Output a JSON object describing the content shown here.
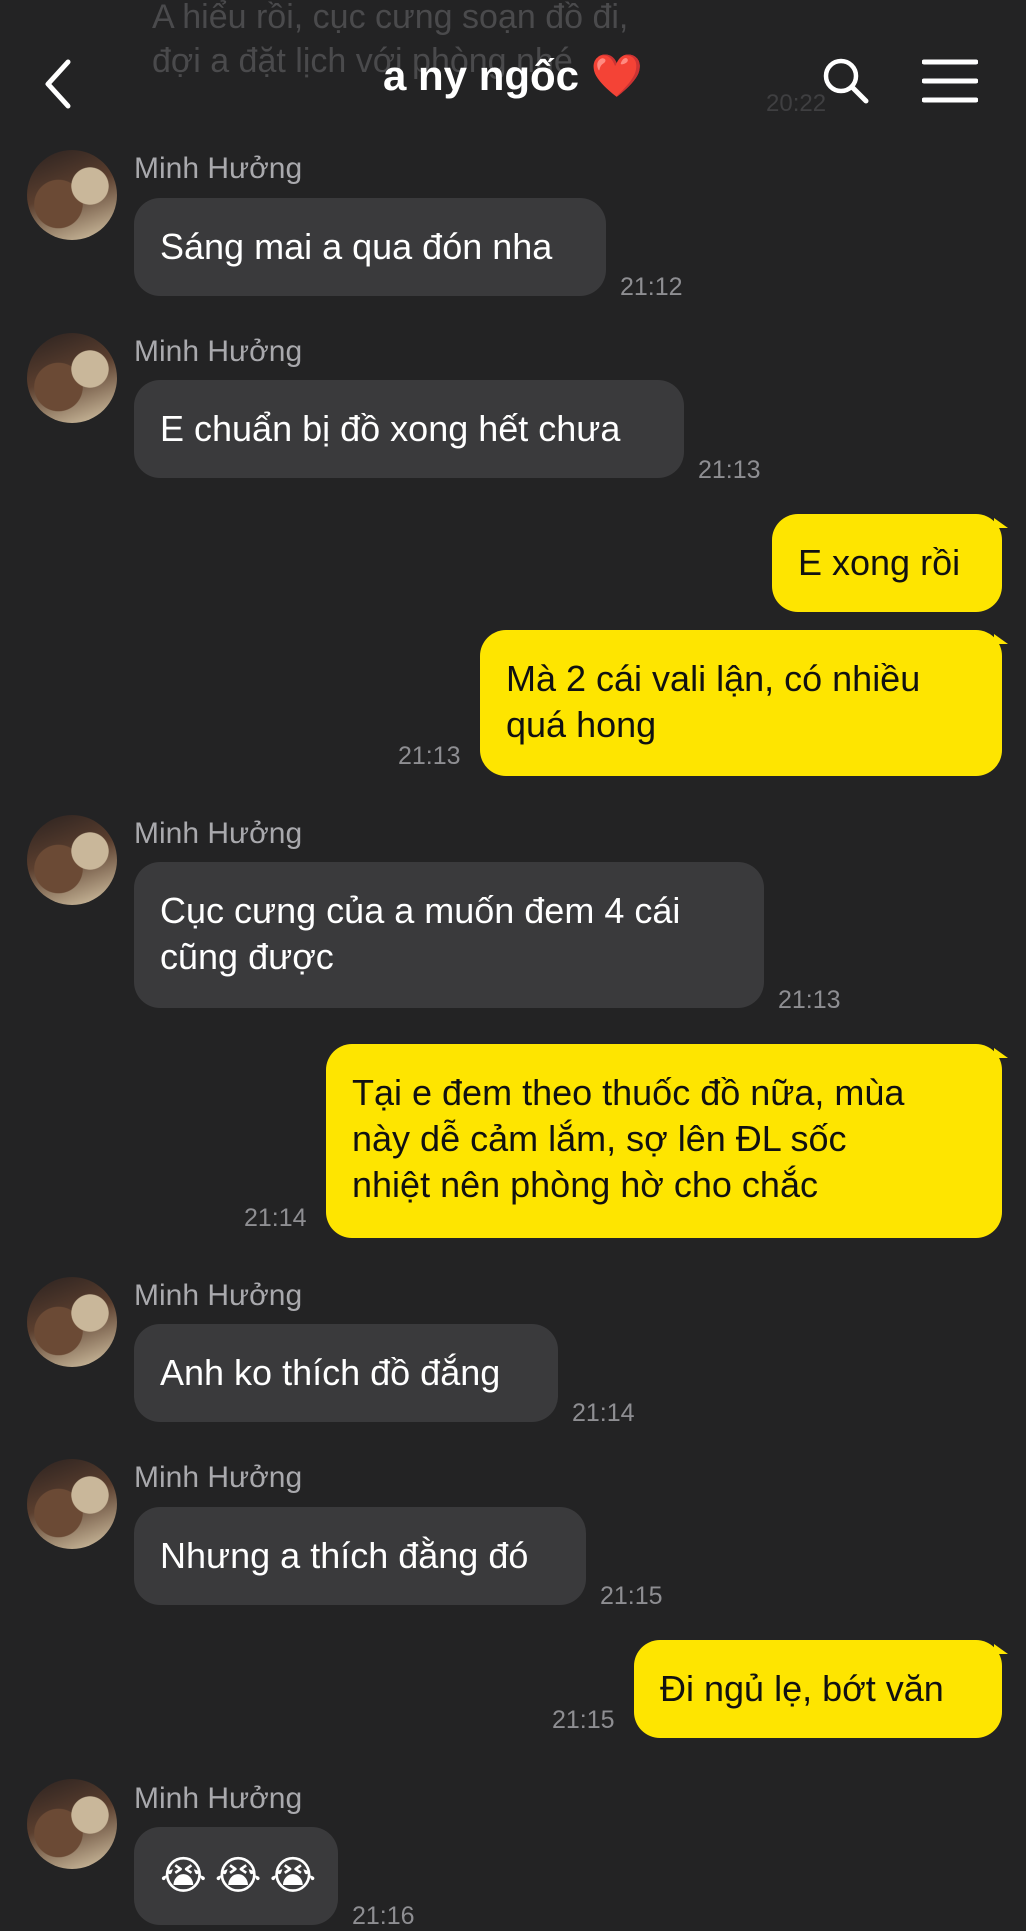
{
  "ghost": {
    "line1": "A hiểu rồi, cục cưng soạn đồ đi,",
    "line2": "đợi a đặt lịch với phòng nhé",
    "time": "20:22"
  },
  "header": {
    "title": "a ny ngốc",
    "heart": "❤️",
    "icons": [
      "back-arrow-icon",
      "search-icon",
      "menu-icon"
    ]
  },
  "colors": {
    "background": "#232324",
    "incoming_bubble": "#3a3a3c",
    "outgoing_bubble": "#fee500",
    "timestamp": "#8e8e92"
  },
  "messages": [
    {
      "direction": "in",
      "sender": "Minh Hưởng",
      "text": "Sáng mai a qua đón nha",
      "time": "21:12"
    },
    {
      "direction": "in",
      "sender": "Minh Hưởng",
      "text": "E chuẩn bị đồ xong hết chưa",
      "time": "21:13"
    },
    {
      "direction": "out",
      "text": "E xong rồi"
    },
    {
      "direction": "out",
      "lines": [
        "Mà 2 cái vali lận, có nhiều",
        "quá hong"
      ],
      "time": "21:13"
    },
    {
      "direction": "in",
      "sender": "Minh Hưởng",
      "lines": [
        "Cục cưng của a muốn đem 4 cái",
        "cũng được"
      ],
      "time": "21:13"
    },
    {
      "direction": "out",
      "lines": [
        "Tại e đem theo thuốc đồ nữa, mùa",
        "này dễ cảm lắm, sợ lên ĐL sốc",
        "nhiệt nên phòng hờ cho chắc"
      ],
      "time": "21:14"
    },
    {
      "direction": "in",
      "sender": "Minh Hưởng",
      "text": "Anh ko thích đồ đắng",
      "time": "21:14"
    },
    {
      "direction": "in",
      "sender": "Minh Hưởng",
      "text": "Nhưng a thích đằng đó",
      "time": "21:15"
    },
    {
      "direction": "out",
      "text": "Đi ngủ lẹ, bớt văn",
      "time": "21:15"
    },
    {
      "direction": "in",
      "sender": "Minh Hưởng",
      "text": "😭😭😭",
      "time": "21:16"
    }
  ]
}
